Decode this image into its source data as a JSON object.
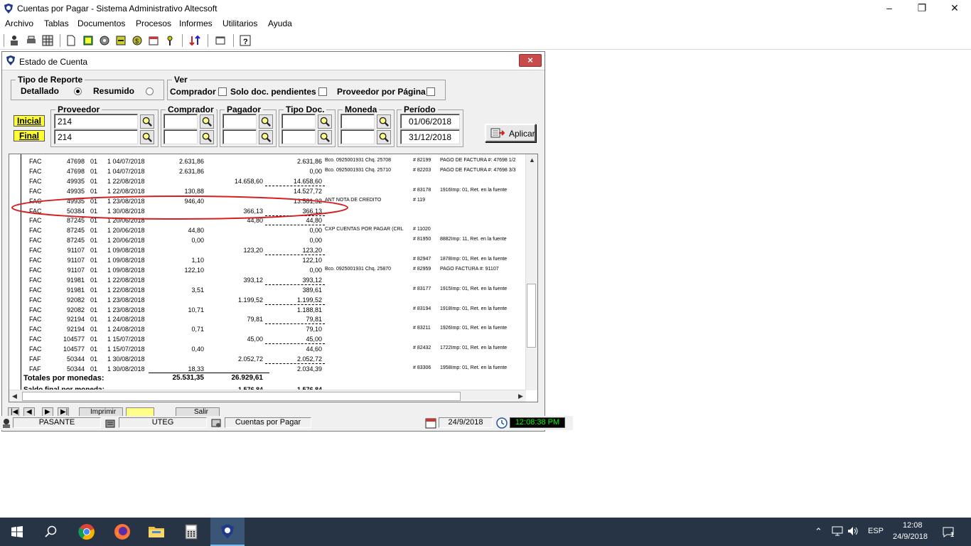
{
  "window": {
    "title": "Cuentas por Pagar - Sistema Administrativo Altecsoft"
  },
  "menu": [
    "Archivo",
    "Tablas",
    "Documentos",
    "Procesos",
    "Informes",
    "Utilitarios",
    "Ayuda"
  ],
  "child": {
    "title": "Estado de Cuenta",
    "close_label": "×",
    "tipo_reporte": {
      "legend": "Tipo de Reporte",
      "detallado": "Detallado",
      "resumido": "Resumido",
      "selected": "Detallado"
    },
    "ver": {
      "legend": "Ver",
      "comprador": "Comprador",
      "pendientes": "Solo doc. pendientes",
      "proveedor_pagina": "Proveedor por Página"
    },
    "filters": {
      "inicial": "Inicial",
      "final": "Final",
      "proveedor": {
        "label": "Proveedor",
        "inicial": "214",
        "final": "214"
      },
      "comprador": {
        "label": "Comprador",
        "inicial": "",
        "final": ""
      },
      "pagador": {
        "label": "Pagador",
        "inicial": "",
        "final": ""
      },
      "tipo_doc": {
        "label": "Tipo Doc.",
        "inicial": "",
        "final": ""
      },
      "moneda": {
        "label": "Moneda",
        "inicial": "",
        "final": ""
      },
      "periodo": {
        "label": "Período",
        "inicial": "01/06/2018",
        "final": "31/12/2018"
      }
    },
    "aplicar_label": "Aplicar"
  },
  "report": {
    "rows": [
      {
        "tipo": "FAC",
        "num": "47698",
        "suc": "01",
        "fecha": "1 04/07/2018",
        "debito": "2.631,86",
        "credito": "",
        "saldo": "2.631,86",
        "ref": "Bco. 0925001931  Chq. 25708",
        "num2": "#  82199",
        "desc": "PAGO DE FACTURA #: 47698 1/2"
      },
      {
        "tipo": "FAC",
        "num": "47698",
        "suc": "01",
        "fecha": "1 04/07/2018",
        "debito": "2.631,86",
        "credito": "",
        "saldo": "0,00",
        "ref": "Bco. 0925001931  Chq. 25710",
        "num2": "#  82203",
        "desc": "PAGO DE FACTURA #: 47698 3/3"
      },
      {
        "tipo": "FAC",
        "num": "49935",
        "suc": "01",
        "fecha": "1 22/08/2018",
        "debito": "",
        "credito": "14.658,60",
        "saldo": "14.658,60",
        "ref": "",
        "num2": "",
        "desc": ""
      },
      {
        "tipo": "FAC",
        "num": "49935",
        "suc": "01",
        "fecha": "1 22/08/2018",
        "debito": "130,88",
        "credito": "",
        "saldo": "14.527,72",
        "ref": "",
        "num2": "#  83178",
        "desc": "1916Imp: 01, Ret. en la fuente"
      },
      {
        "tipo": "FAC",
        "num": "49935",
        "suc": "01",
        "fecha": "1 23/08/2018",
        "debito": "946,40",
        "credito": "",
        "saldo": "13.581,32",
        "ref": "ANT NOTA DE CREDITO",
        "num2": "#  119",
        "desc": ""
      },
      {
        "tipo": "FAC",
        "num": "50384",
        "suc": "01",
        "fecha": "1 30/08/2018",
        "debito": "",
        "credito": "366,13",
        "saldo": "366,13",
        "ref": "",
        "num2": "",
        "desc": ""
      },
      {
        "tipo": "FAC",
        "num": "87245",
        "suc": "01",
        "fecha": "1 20/06/2018",
        "debito": "",
        "credito": "44,80",
        "saldo": "44,80",
        "ref": "",
        "num2": "",
        "desc": ""
      },
      {
        "tipo": "FAC",
        "num": "87245",
        "suc": "01",
        "fecha": "1 20/06/2018",
        "debito": "44,80",
        "credito": "",
        "saldo": "0,00",
        "ref": "CXP CUENTAS POR PAGAR (CRL",
        "num2": "#  11020",
        "desc": ""
      },
      {
        "tipo": "FAC",
        "num": "87245",
        "suc": "01",
        "fecha": "1 20/06/2018",
        "debito": "0,00",
        "credito": "",
        "saldo": "0,00",
        "ref": "",
        "num2": "#  81950",
        "desc": "8882Imp: 11, Ret. en la fuente"
      },
      {
        "tipo": "FAC",
        "num": "91107",
        "suc": "01",
        "fecha": "1 09/08/2018",
        "debito": "",
        "credito": "123,20",
        "saldo": "123,20",
        "ref": "",
        "num2": "",
        "desc": ""
      },
      {
        "tipo": "FAC",
        "num": "91107",
        "suc": "01",
        "fecha": "1 09/08/2018",
        "debito": "1,10",
        "credito": "",
        "saldo": "122,10",
        "ref": "",
        "num2": "#  82947",
        "desc": "1878Imp: 01, Ret. en la fuente"
      },
      {
        "tipo": "FAC",
        "num": "91107",
        "suc": "01",
        "fecha": "1 09/08/2018",
        "debito": "122,10",
        "credito": "",
        "saldo": "0,00",
        "ref": "Bco. 0925001931  Chq. 25870",
        "num2": "#  82959",
        "desc": "PAGO FACTURA #: 91107"
      },
      {
        "tipo": "FAC",
        "num": "91981",
        "suc": "01",
        "fecha": "1 22/08/2018",
        "debito": "",
        "credito": "393,12",
        "saldo": "393,12",
        "ref": "",
        "num2": "",
        "desc": ""
      },
      {
        "tipo": "FAC",
        "num": "91981",
        "suc": "01",
        "fecha": "1 22/08/2018",
        "debito": "3,51",
        "credito": "",
        "saldo": "389,61",
        "ref": "",
        "num2": "#  83177",
        "desc": "1915Imp: 01, Ret. en la fuente"
      },
      {
        "tipo": "FAC",
        "num": "92082",
        "suc": "01",
        "fecha": "1 23/08/2018",
        "debito": "",
        "credito": "1.199,52",
        "saldo": "1.199,52",
        "ref": "",
        "num2": "",
        "desc": ""
      },
      {
        "tipo": "FAC",
        "num": "92082",
        "suc": "01",
        "fecha": "1 23/08/2018",
        "debito": "10,71",
        "credito": "",
        "saldo": "1.188,81",
        "ref": "",
        "num2": "#  83194",
        "desc": "1918Imp: 01, Ret. en la fuente"
      },
      {
        "tipo": "FAC",
        "num": "92194",
        "suc": "01",
        "fecha": "1 24/08/2018",
        "debito": "",
        "credito": "79,81",
        "saldo": "79,81",
        "ref": "",
        "num2": "",
        "desc": ""
      },
      {
        "tipo": "FAC",
        "num": "92194",
        "suc": "01",
        "fecha": "1 24/08/2018",
        "debito": "0,71",
        "credito": "",
        "saldo": "79,10",
        "ref": "",
        "num2": "#  83211",
        "desc": "1926Imp: 01, Ret. en la fuente"
      },
      {
        "tipo": "FAC",
        "num": "104577",
        "suc": "01",
        "fecha": "1 15/07/2018",
        "debito": "",
        "credito": "45,00",
        "saldo": "45,00",
        "ref": "",
        "num2": "",
        "desc": ""
      },
      {
        "tipo": "FAC",
        "num": "104577",
        "suc": "01",
        "fecha": "1 15/07/2018",
        "debito": "0,40",
        "credito": "",
        "saldo": "44,60",
        "ref": "",
        "num2": "#  82432",
        "desc": "1722Imp: 01, Ret. en la fuente"
      },
      {
        "tipo": "FAF",
        "num": "50344",
        "suc": "01",
        "fecha": "1 30/08/2018",
        "debito": "",
        "credito": "2.052,72",
        "saldo": "2.052,72",
        "ref": "",
        "num2": "",
        "desc": ""
      },
      {
        "tipo": "FAF",
        "num": "50344",
        "suc": "01",
        "fecha": "1 30/08/2018",
        "debito": "18,33",
        "credito": "",
        "saldo": "2.034,39",
        "ref": "",
        "num2": "#  83306",
        "desc": "1958Imp: 01, Ret. en la fuente"
      }
    ],
    "totales_label": "Totales por monedas:",
    "total_debito": "25.531,35",
    "total_credito": "26.929,61",
    "saldo_label": "Saldo final por moneda:",
    "saldo_final_credito": "1.576,84",
    "saldo_final": "1.576,84"
  },
  "navbar": {
    "imprimir": "Imprimir",
    "salir": "Salir"
  },
  "status": {
    "user": "PASANTE",
    "company": "UTEG",
    "module": "Cuentas por Pagar",
    "date": "24/9/2018",
    "time": "12:08:38 PM"
  },
  "taskbar": {
    "lang": "ESP",
    "time": "12:08",
    "date": "24/9/2018",
    "notifications": "1"
  },
  "colors": {
    "highlight": "#ffff33",
    "annotation": "#d42020",
    "taskbar": "#263445",
    "clock_bg": "#000000",
    "clock_fg": "#00ff00"
  }
}
